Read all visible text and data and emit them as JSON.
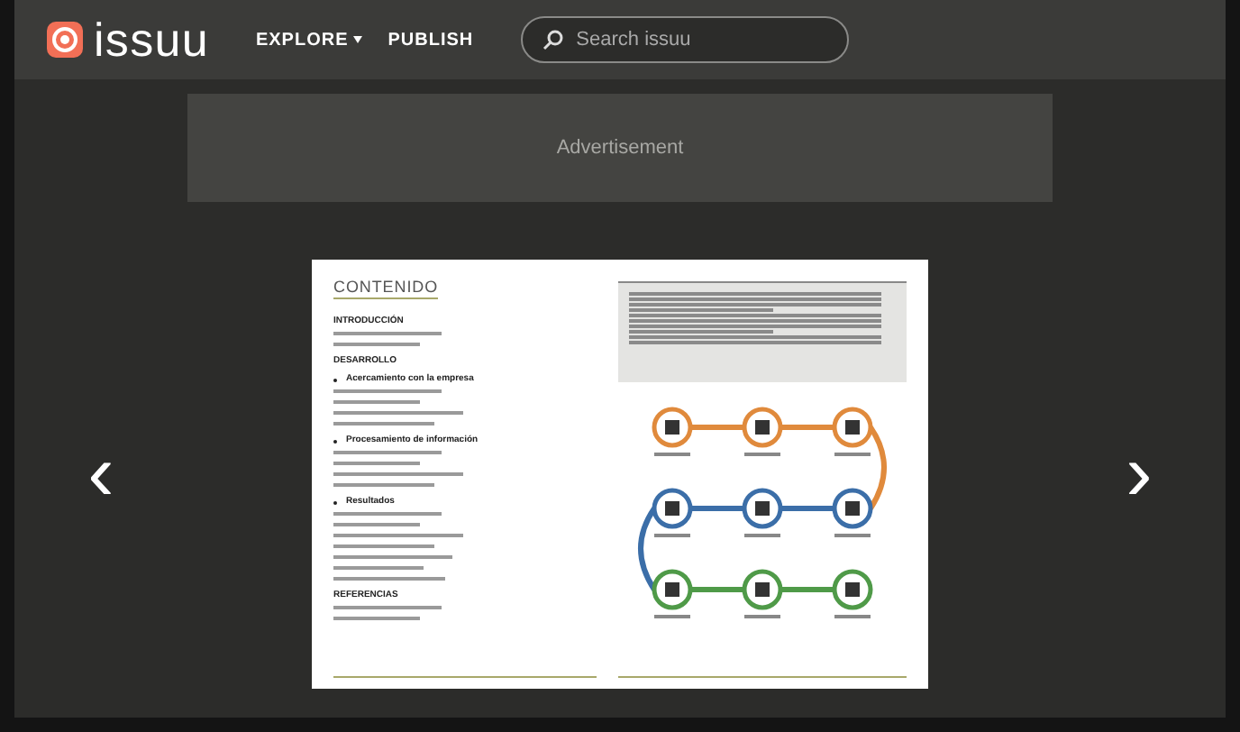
{
  "header": {
    "logo": "issuu",
    "nav": [
      {
        "label": "EXPLORE",
        "dropdown": true
      },
      {
        "label": "PUBLISH",
        "dropdown": false
      }
    ],
    "search": {
      "placeholder": "Search issuu"
    }
  },
  "ad": {
    "label": "Advertisement"
  },
  "document": {
    "title": "CONTENIDO",
    "sections": [
      {
        "heading": "INTRODUCCIÓN",
        "bullet": false
      },
      {
        "heading": "DESARROLLO",
        "bullet": false
      },
      {
        "heading": "Acercamiento con la empresa",
        "bullet": true
      },
      {
        "heading": "Procesamiento de información",
        "bullet": true
      },
      {
        "heading": "Resultados",
        "bullet": true
      },
      {
        "heading": "REFERENCIAS",
        "bullet": false
      }
    ]
  },
  "nav_arrows": {
    "prev": "‹",
    "next": "›"
  }
}
